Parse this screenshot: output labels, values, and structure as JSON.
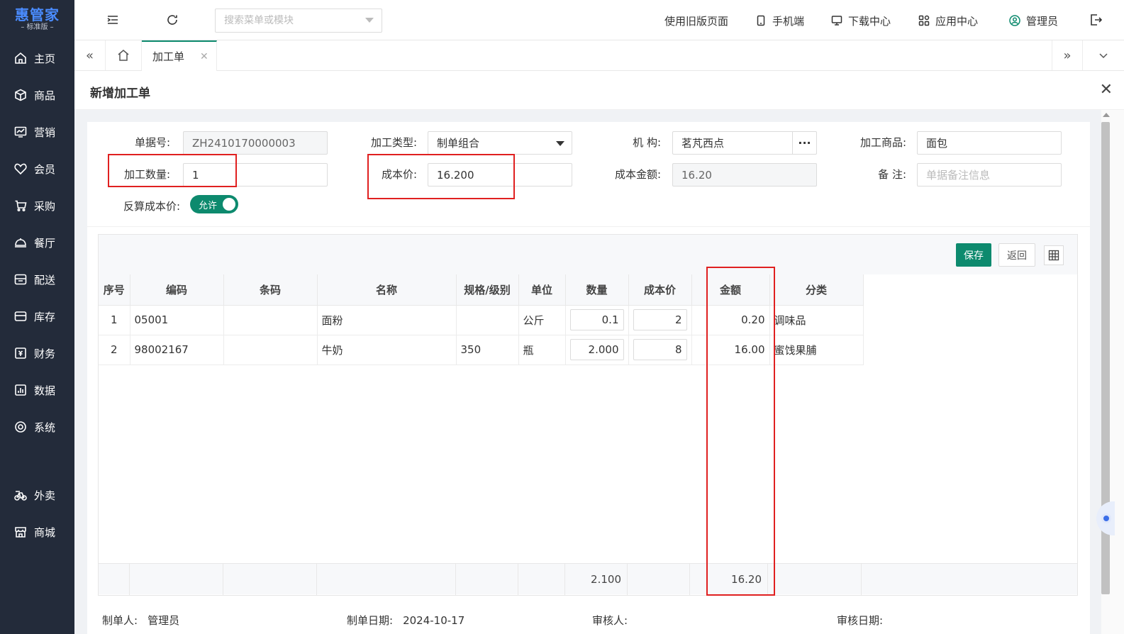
{
  "app": {
    "logo_main": "惠管家",
    "logo_sub": "– 标准版 –"
  },
  "sidebar": {
    "items": [
      {
        "label": "主页",
        "icon": "home-icon"
      },
      {
        "label": "商品",
        "icon": "box-icon"
      },
      {
        "label": "营销",
        "icon": "chart-icon"
      },
      {
        "label": "会员",
        "icon": "heart-icon"
      },
      {
        "label": "采购",
        "icon": "cart-icon"
      },
      {
        "label": "餐厅",
        "icon": "dish-icon"
      },
      {
        "label": "配送",
        "icon": "truck-icon"
      },
      {
        "label": "库存",
        "icon": "warehouse-icon"
      },
      {
        "label": "财务",
        "icon": "finance-icon"
      },
      {
        "label": "数据",
        "icon": "data-icon"
      },
      {
        "label": "系统",
        "icon": "settings-icon"
      },
      {
        "label": "外卖",
        "icon": "bike-icon"
      },
      {
        "label": "商城",
        "icon": "store-icon"
      }
    ]
  },
  "topbar": {
    "search_placeholder": "搜索菜单或模块",
    "links": {
      "old_page": "使用旧版页面",
      "mobile": "手机端",
      "download": "下载中心",
      "apps": "应用中心",
      "user": "管理员"
    }
  },
  "tabs": {
    "active_label": "加工单"
  },
  "page": {
    "title": "新增加工单"
  },
  "form": {
    "doc_no_label": "单据号:",
    "doc_no_value": "ZH2410170000003",
    "proc_type_label": "加工类型:",
    "proc_type_value": "制单组合",
    "org_label": "机  构:",
    "org_value": "茗芃西点",
    "proc_goods_label": "加工商品:",
    "proc_goods_value": "面包",
    "proc_qty_label": "加工数量:",
    "proc_qty_value": "1",
    "cost_price_label": "成本价:",
    "cost_price_value": "16.200",
    "cost_amount_label": "成本金额:",
    "cost_amount_value": "16.20",
    "remark_label": "备  注:",
    "remark_placeholder": "单据备注信息",
    "reverse_label": "反算成本价:",
    "reverse_toggle": "允许"
  },
  "grid": {
    "save_label": "保存",
    "back_label": "返回",
    "headers": [
      "序号",
      "编码",
      "条码",
      "名称",
      "规格/级别",
      "单位",
      "数量",
      "成本价",
      "金额",
      "分类"
    ],
    "rows": [
      {
        "no": "1",
        "code": "05001",
        "barcode": "",
        "name": "面粉",
        "spec": "",
        "unit": "公斤",
        "qty": "0.1",
        "cost": "2",
        "amount": "0.20",
        "category": "调味品"
      },
      {
        "no": "2",
        "code": "98002167",
        "barcode": "",
        "name": "牛奶",
        "spec": "350",
        "unit": "瓶",
        "qty": "2.000",
        "cost": "8",
        "amount": "16.00",
        "category": "蜜饯果脯"
      }
    ],
    "footer": {
      "qty_total": "2.100",
      "amount_total": "16.20"
    }
  },
  "meta": {
    "creator_label": "制单人:",
    "creator_value": "管理员",
    "create_date_label": "制单日期:",
    "create_date_value": "2024-10-17",
    "auditor_label": "审核人:",
    "audit_date_label": "审核日期:"
  },
  "colors": {
    "sidebar_bg": "#232b3a",
    "accent": "#0d8a6e",
    "highlight": "#e02020"
  }
}
